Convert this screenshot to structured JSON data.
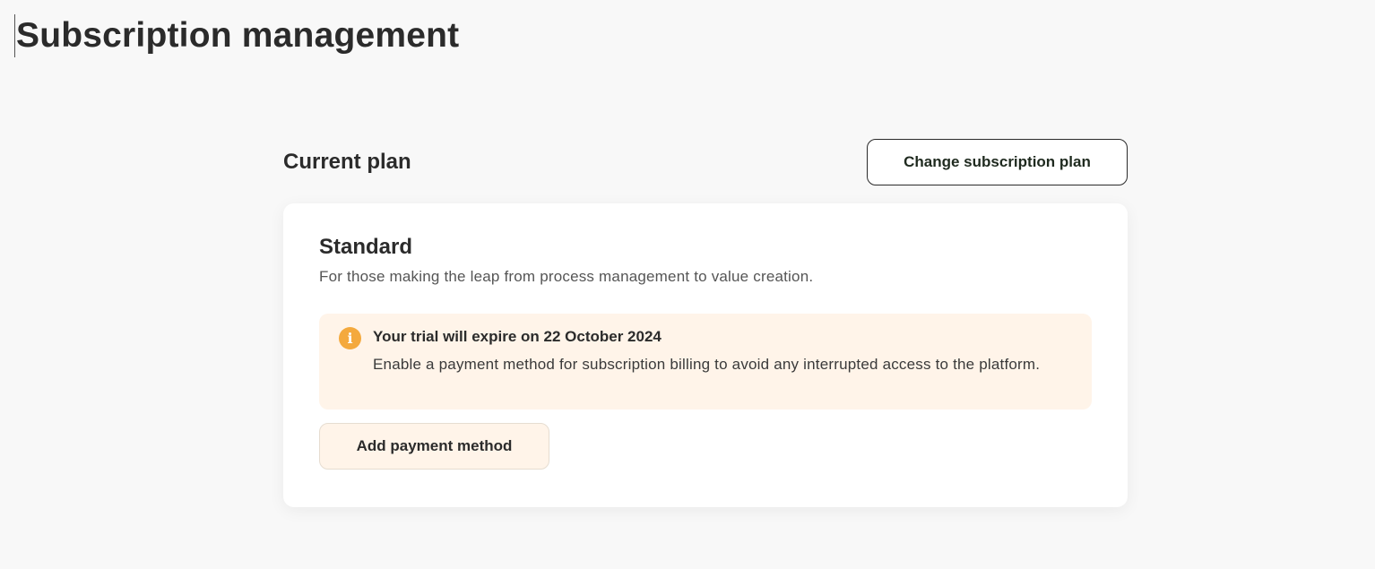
{
  "page": {
    "title": "Subscription management"
  },
  "current_plan": {
    "section_title": "Current plan",
    "change_button_label": "Change subscription plan",
    "plan_name": "Standard",
    "plan_description": "For those making the leap from process management to value creation."
  },
  "trial_alert": {
    "icon": "info-icon",
    "icon_glyph": "i",
    "title": "Your trial will expire on 22 October 2024",
    "message": "Enable a payment method for subscription billing to avoid any interrupted access to the platform."
  },
  "actions": {
    "add_payment_label": "Add payment method"
  },
  "colors": {
    "background": "#f8f8f8",
    "alert_background": "#fff4e9",
    "info_icon": "#f4a93d"
  }
}
